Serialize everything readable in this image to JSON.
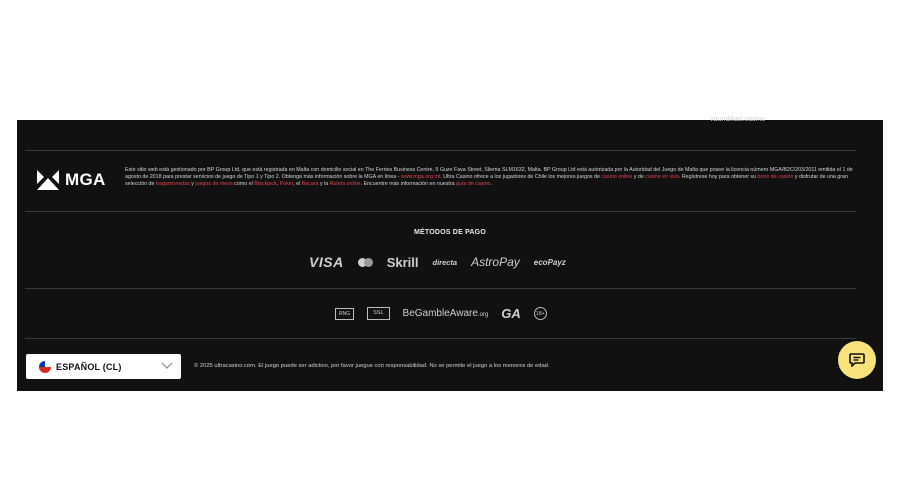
{
  "footer": {
    "top_link": "vaundikas.casino",
    "mga_logo": "MGA",
    "license": {
      "p1": "Este sitio web está gestionado por BP Group Ltd, que está registrada en Malta con domicilio social en The Ferries Business Centre, 9 Guze Fava Street, Sliema SLM1632, Malta. BP Group Ltd está autorizada por la Autoridad del Juego de Malta que posee la licencia número MGA/B2C/203/2011 emitida el 1 de agosto de 2018 para prestar servicios de juego de Tipo 1 y Tipo 2. Obtenga más información sobre la MGA en línea - ",
      "link_mga": "www.mga.org.mt",
      "p2": ". Ultra Casino ofrece a los jugadores de Chile los mejores juegos de ",
      "link_casino_online": "casino online",
      "p3": " y de ",
      "link_casino_vivo": "casino en vivo",
      "p4": ". Regístrese hoy para obtener su ",
      "link_bono": "bono de casino",
      "p5": " y disfrutar de una gran selección de ",
      "link_tragamonedas": "tragamonedas",
      "p6": " y ",
      "link_mesa": "juegos de mesa",
      "p7": " como el ",
      "link_blackjack": "Blackjack",
      "p8": ", ",
      "link_poker": "Poker",
      "p9": ", el ",
      "link_bacara": "Bacara",
      "p10": " y la ",
      "link_ruleta": "Ruleta online",
      "p11": ". Encuentre más información en nuestra ",
      "link_guia": "guía de casino",
      "p12": "."
    },
    "payments_title": "MÉTODOS DE PAGO",
    "payments": {
      "visa": "VISA",
      "skrill": "Skrill",
      "directa": "directa",
      "astropay": "AstroPay",
      "ecopayz": "ecoPayz"
    },
    "certs": {
      "rng": "RNG",
      "ssl": "SSL",
      "begamble": "BeGambleAware",
      "begamble_suffix": ".org",
      "ga": "GA",
      "age": "18+"
    },
    "language": "ESPAÑOL (CL)",
    "copyright": "© 2025 ultracasino.com. El juego puede ser adictivo, por favor juegue con responsabilidad. No se permite el juego a los menores de edad."
  },
  "icons": {
    "chat": "chat-icon",
    "chevron": "chevron-down-icon",
    "flag": "chile-flag-icon"
  },
  "colors": {
    "footer_bg": "#111111",
    "link": "#e0434a",
    "chat_bg": "#f7e27c"
  }
}
